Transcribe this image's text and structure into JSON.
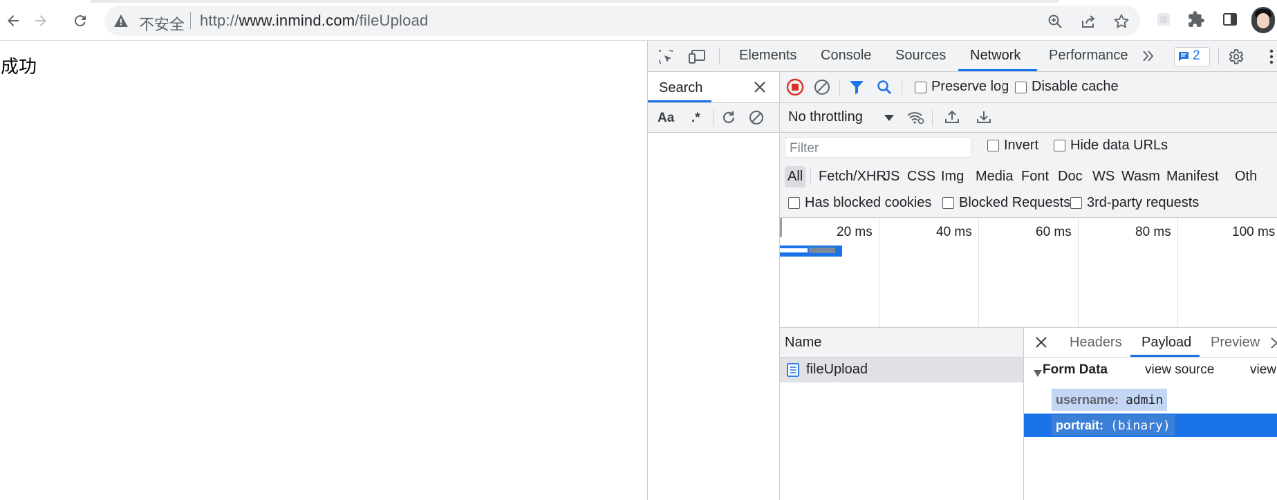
{
  "browser": {
    "security_label": "不安全",
    "url_prefix": "http://",
    "url_host": "www.inmind.com",
    "url_path": "/fileUpload"
  },
  "page": {
    "text": "成功"
  },
  "devtools": {
    "tabs": [
      "Elements",
      "Console",
      "Sources",
      "Network",
      "Performance"
    ],
    "active_tab": "Network",
    "issues_count": "2",
    "search": {
      "title": "Search",
      "match_case": "Aa",
      "regex": ".*"
    },
    "network": {
      "preserve_log": "Preserve log",
      "disable_cache": "Disable cache",
      "throttling": "No throttling",
      "filter_placeholder": "Filter",
      "invert": "Invert",
      "hide_data_urls": "Hide data URLs",
      "types": [
        "All",
        "Fetch/XHR",
        "JS",
        "CSS",
        "Img",
        "Media",
        "Font",
        "Doc",
        "WS",
        "Wasm",
        "Manifest",
        "Oth"
      ],
      "has_blocked_cookies": "Has blocked cookies",
      "blocked_requests": "Blocked Requests",
      "third_party": "3rd-party requests",
      "ticks": [
        "20 ms",
        "40 ms",
        "60 ms",
        "80 ms",
        "100 ms"
      ],
      "name_header": "Name",
      "requests": [
        {
          "name": "fileUpload"
        }
      ],
      "detail_tabs": [
        "Headers",
        "Payload",
        "Preview"
      ],
      "active_detail_tab": "Payload",
      "form_data": {
        "title": "Form Data",
        "view_source": "view source",
        "view_decoded": "view",
        "fields": [
          {
            "key": "username:",
            "value": "admin"
          },
          {
            "key": "portrait:",
            "value": "(binary)"
          }
        ]
      }
    }
  }
}
